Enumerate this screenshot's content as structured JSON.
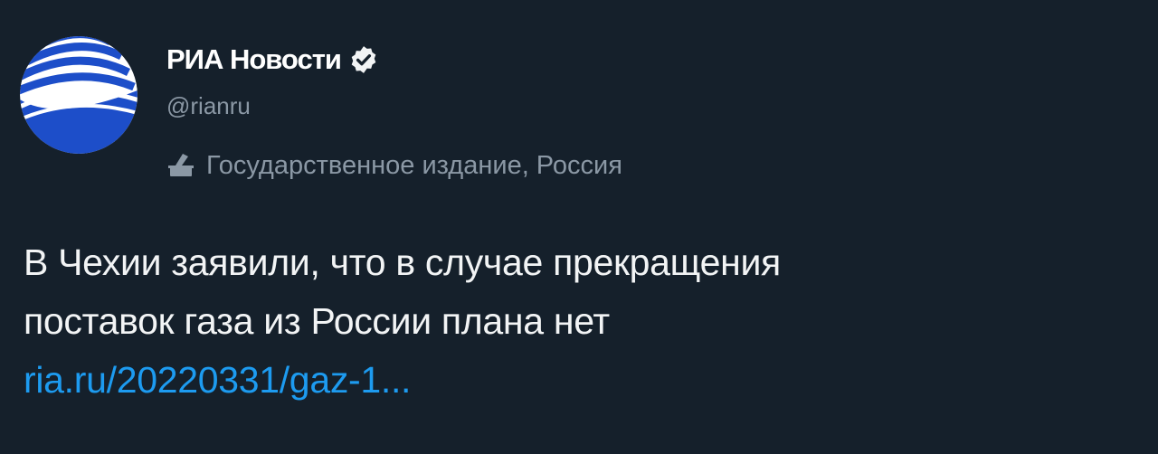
{
  "author": {
    "name": "РИА Новости",
    "handle": "@rianru",
    "verified": true,
    "label": "Государственное издание, Россия"
  },
  "tweet": {
    "lines": [
      "В Чехии заявили, что в случае прекращения",
      "поставок газа из России плана нет"
    ],
    "link": "ria.ru/20220331/gaz-1..."
  },
  "icons": {
    "avatar": "ria-novosti-logo",
    "verified": "verified-badge-icon",
    "label": "ballot-box-icon"
  },
  "colors": {
    "background": "#15202b",
    "text": "#e7e9ea",
    "muted": "#8b98a5",
    "link": "#1d9bf0",
    "avatar_blue": "#1d4ec9"
  }
}
